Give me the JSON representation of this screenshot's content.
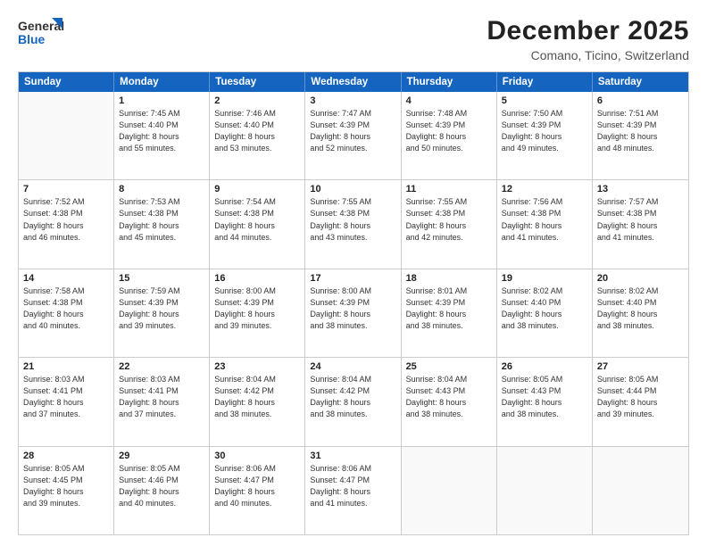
{
  "logo": {
    "line1": "General",
    "line2": "Blue"
  },
  "title": "December 2025",
  "subtitle": "Comano, Ticino, Switzerland",
  "days": [
    "Sunday",
    "Monday",
    "Tuesday",
    "Wednesday",
    "Thursday",
    "Friday",
    "Saturday"
  ],
  "weeks": [
    [
      {
        "day": "",
        "info": ""
      },
      {
        "day": "1",
        "info": "Sunrise: 7:45 AM\nSunset: 4:40 PM\nDaylight: 8 hours\nand 55 minutes."
      },
      {
        "day": "2",
        "info": "Sunrise: 7:46 AM\nSunset: 4:40 PM\nDaylight: 8 hours\nand 53 minutes."
      },
      {
        "day": "3",
        "info": "Sunrise: 7:47 AM\nSunset: 4:39 PM\nDaylight: 8 hours\nand 52 minutes."
      },
      {
        "day": "4",
        "info": "Sunrise: 7:48 AM\nSunset: 4:39 PM\nDaylight: 8 hours\nand 50 minutes."
      },
      {
        "day": "5",
        "info": "Sunrise: 7:50 AM\nSunset: 4:39 PM\nDaylight: 8 hours\nand 49 minutes."
      },
      {
        "day": "6",
        "info": "Sunrise: 7:51 AM\nSunset: 4:39 PM\nDaylight: 8 hours\nand 48 minutes."
      }
    ],
    [
      {
        "day": "7",
        "info": "Sunrise: 7:52 AM\nSunset: 4:38 PM\nDaylight: 8 hours\nand 46 minutes."
      },
      {
        "day": "8",
        "info": "Sunrise: 7:53 AM\nSunset: 4:38 PM\nDaylight: 8 hours\nand 45 minutes."
      },
      {
        "day": "9",
        "info": "Sunrise: 7:54 AM\nSunset: 4:38 PM\nDaylight: 8 hours\nand 44 minutes."
      },
      {
        "day": "10",
        "info": "Sunrise: 7:55 AM\nSunset: 4:38 PM\nDaylight: 8 hours\nand 43 minutes."
      },
      {
        "day": "11",
        "info": "Sunrise: 7:55 AM\nSunset: 4:38 PM\nDaylight: 8 hours\nand 42 minutes."
      },
      {
        "day": "12",
        "info": "Sunrise: 7:56 AM\nSunset: 4:38 PM\nDaylight: 8 hours\nand 41 minutes."
      },
      {
        "day": "13",
        "info": "Sunrise: 7:57 AM\nSunset: 4:38 PM\nDaylight: 8 hours\nand 41 minutes."
      }
    ],
    [
      {
        "day": "14",
        "info": "Sunrise: 7:58 AM\nSunset: 4:38 PM\nDaylight: 8 hours\nand 40 minutes."
      },
      {
        "day": "15",
        "info": "Sunrise: 7:59 AM\nSunset: 4:39 PM\nDaylight: 8 hours\nand 39 minutes."
      },
      {
        "day": "16",
        "info": "Sunrise: 8:00 AM\nSunset: 4:39 PM\nDaylight: 8 hours\nand 39 minutes."
      },
      {
        "day": "17",
        "info": "Sunrise: 8:00 AM\nSunset: 4:39 PM\nDaylight: 8 hours\nand 38 minutes."
      },
      {
        "day": "18",
        "info": "Sunrise: 8:01 AM\nSunset: 4:39 PM\nDaylight: 8 hours\nand 38 minutes."
      },
      {
        "day": "19",
        "info": "Sunrise: 8:02 AM\nSunset: 4:40 PM\nDaylight: 8 hours\nand 38 minutes."
      },
      {
        "day": "20",
        "info": "Sunrise: 8:02 AM\nSunset: 4:40 PM\nDaylight: 8 hours\nand 38 minutes."
      }
    ],
    [
      {
        "day": "21",
        "info": "Sunrise: 8:03 AM\nSunset: 4:41 PM\nDaylight: 8 hours\nand 37 minutes."
      },
      {
        "day": "22",
        "info": "Sunrise: 8:03 AM\nSunset: 4:41 PM\nDaylight: 8 hours\nand 37 minutes."
      },
      {
        "day": "23",
        "info": "Sunrise: 8:04 AM\nSunset: 4:42 PM\nDaylight: 8 hours\nand 38 minutes."
      },
      {
        "day": "24",
        "info": "Sunrise: 8:04 AM\nSunset: 4:42 PM\nDaylight: 8 hours\nand 38 minutes."
      },
      {
        "day": "25",
        "info": "Sunrise: 8:04 AM\nSunset: 4:43 PM\nDaylight: 8 hours\nand 38 minutes."
      },
      {
        "day": "26",
        "info": "Sunrise: 8:05 AM\nSunset: 4:43 PM\nDaylight: 8 hours\nand 38 minutes."
      },
      {
        "day": "27",
        "info": "Sunrise: 8:05 AM\nSunset: 4:44 PM\nDaylight: 8 hours\nand 39 minutes."
      }
    ],
    [
      {
        "day": "28",
        "info": "Sunrise: 8:05 AM\nSunset: 4:45 PM\nDaylight: 8 hours\nand 39 minutes."
      },
      {
        "day": "29",
        "info": "Sunrise: 8:05 AM\nSunset: 4:46 PM\nDaylight: 8 hours\nand 40 minutes."
      },
      {
        "day": "30",
        "info": "Sunrise: 8:06 AM\nSunset: 4:47 PM\nDaylight: 8 hours\nand 40 minutes."
      },
      {
        "day": "31",
        "info": "Sunrise: 8:06 AM\nSunset: 4:47 PM\nDaylight: 8 hours\nand 41 minutes."
      },
      {
        "day": "",
        "info": ""
      },
      {
        "day": "",
        "info": ""
      },
      {
        "day": "",
        "info": ""
      }
    ]
  ]
}
